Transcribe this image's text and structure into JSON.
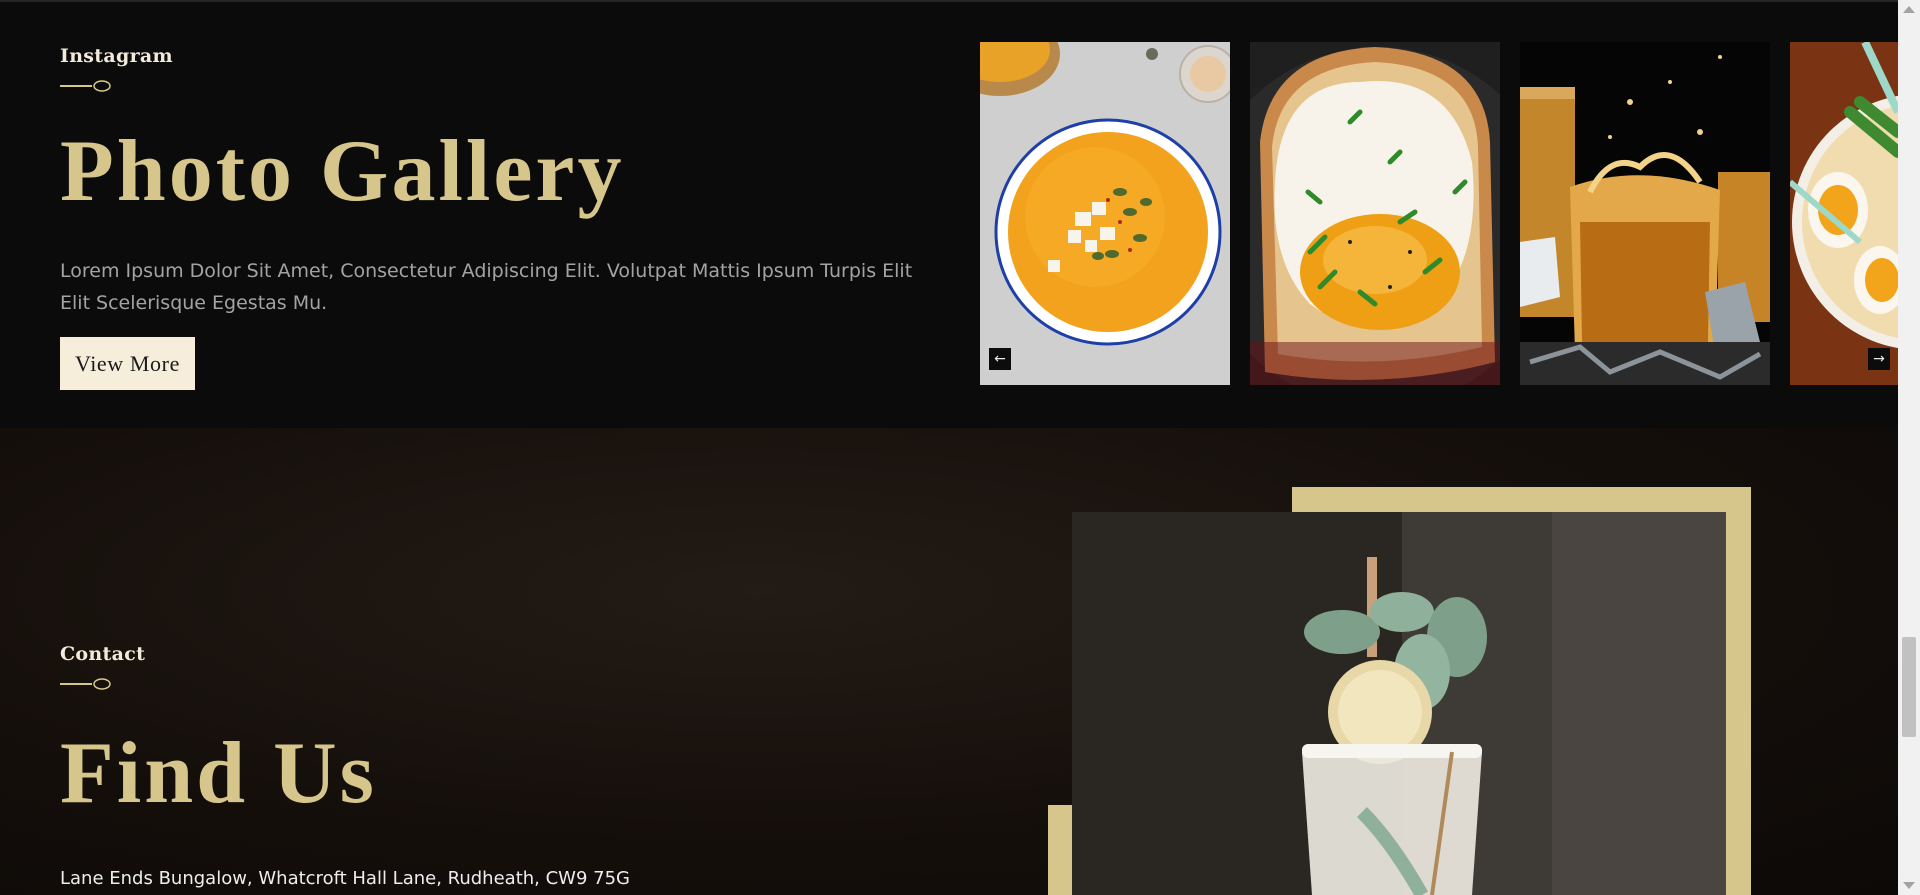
{
  "gallery": {
    "eyebrow": "Instagram",
    "title": "Photo Gallery",
    "description": "Lorem Ipsum Dolor Sit Amet, Consectetur Adipiscing Elit. Volutpat Mattis Ipsum Turpis Elit Elit Scelerisque Egestas Mu.",
    "button_label": "View More",
    "prev_arrow": "←",
    "next_arrow": "→",
    "photos": [
      "pumpkin-soup-photo",
      "fried-egg-toast-photo",
      "whiskey-glasses-photo",
      "ramen-eggs-photo"
    ]
  },
  "contact": {
    "eyebrow": "Contact",
    "title": "Find Us",
    "address": "Lane Ends Bungalow, Whatcroft Hall Lane, Rudheath, CW9 75G"
  },
  "colors": {
    "background": "#0b0b0b",
    "gold_accent": "#d7c68b",
    "button_background": "#f6eedb",
    "body_text": "#a3a3a3"
  },
  "icons": [
    "spoon-divider-icon",
    "arrow-left-icon",
    "arrow-right-icon"
  ]
}
